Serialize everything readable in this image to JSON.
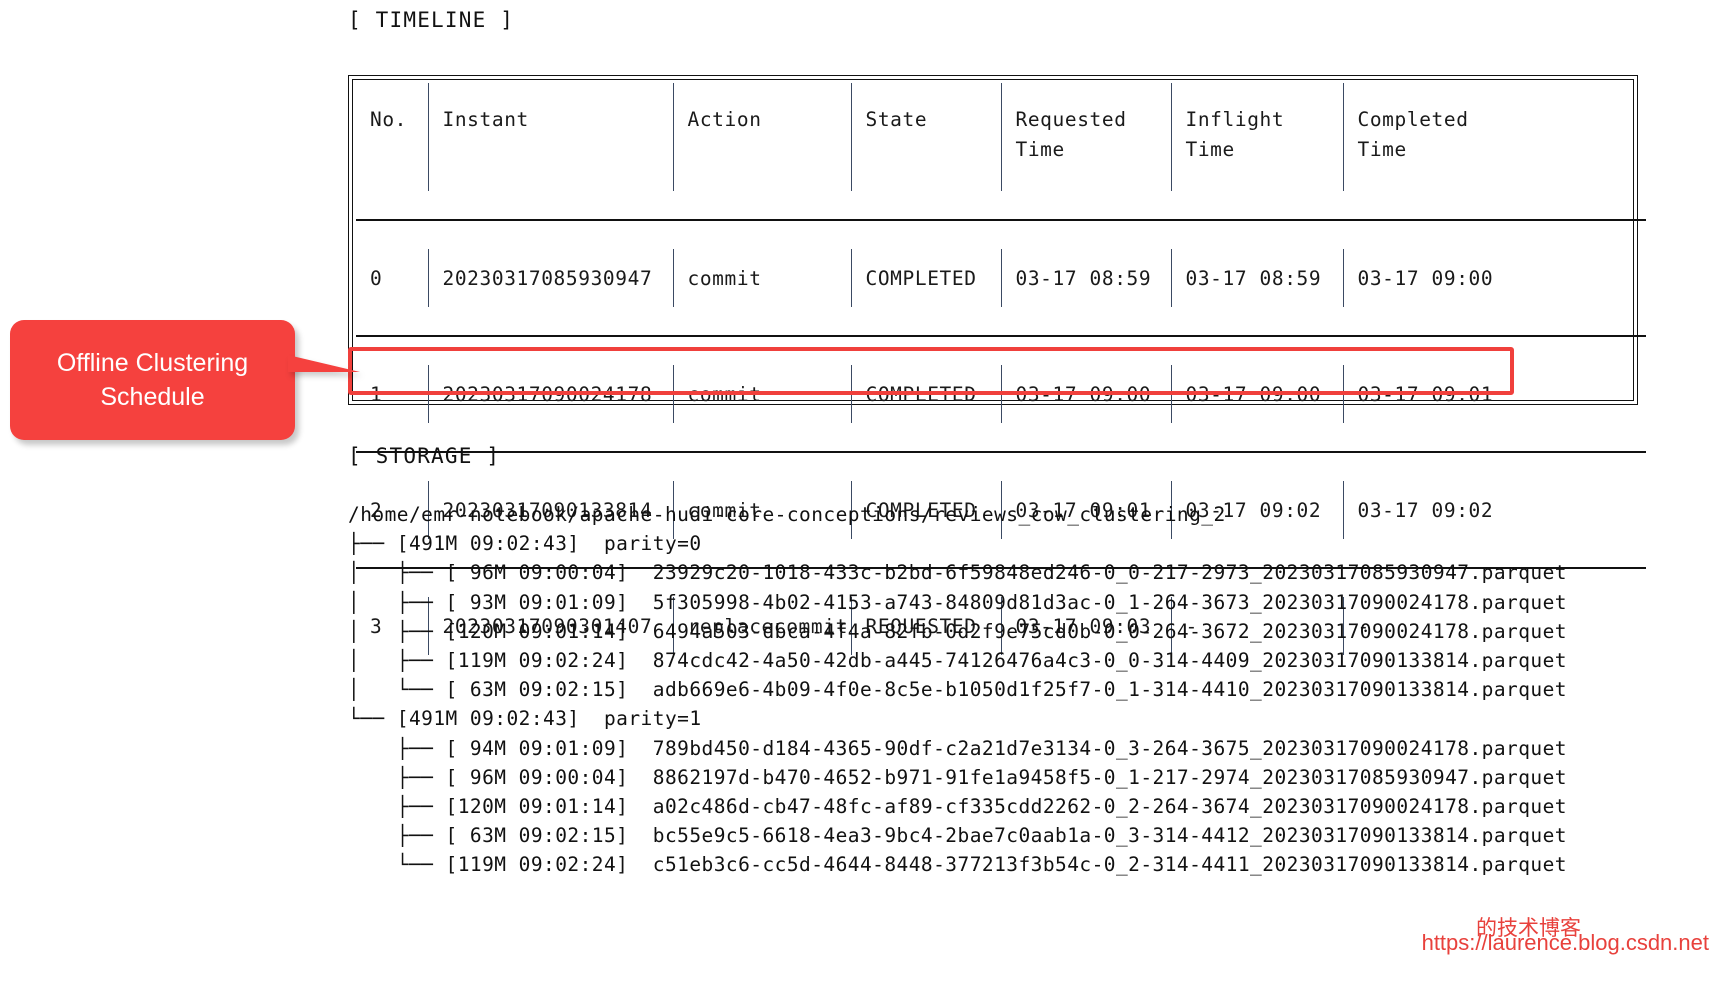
{
  "timeline": {
    "section_label": "[ TIMELINE ]",
    "columns": [
      "No.",
      "Instant",
      "Action",
      "State",
      "Requested\nTime",
      "Inflight\nTime",
      "Completed\nTime"
    ],
    "rows": [
      {
        "no": "0",
        "instant": "20230317085930947",
        "action": "commit",
        "state": "COMPLETED",
        "requested_time": "03-17 08:59",
        "inflight_time": "03-17 08:59",
        "completed_time": "03-17 09:00",
        "highlighted": false
      },
      {
        "no": "1",
        "instant": "20230317090024178",
        "action": "commit",
        "state": "COMPLETED",
        "requested_time": "03-17 09:00",
        "inflight_time": "03-17 09:00",
        "completed_time": "03-17 09:01",
        "highlighted": false
      },
      {
        "no": "2",
        "instant": "20230317090133814",
        "action": "commit",
        "state": "COMPLETED",
        "requested_time": "03-17 09:01",
        "inflight_time": "03-17 09:02",
        "completed_time": "03-17 09:02",
        "highlighted": false
      },
      {
        "no": "3",
        "instant": "20230317090301407",
        "action": "replacecommit",
        "state": "REQUESTED",
        "requested_time": "03-17 09:03",
        "inflight_time": "-",
        "completed_time": "-",
        "highlighted": true
      }
    ]
  },
  "callout": {
    "text": "Offline Clustering\nSchedule",
    "color": "#f5413e"
  },
  "storage": {
    "section_label": "[ STORAGE ]",
    "root_path": "/home/emr-notebook/apache-hudi-core-conceptions/reviews_cow_clustering_2",
    "tree_text": "/home/emr-notebook/apache-hudi-core-conceptions/reviews_cow_clustering_2\n├── [491M 09:02:43]  parity=0\n│   ├── [ 96M 09:00:04]  23929c20-1018-433c-b2bd-6f59848ed246-0_0-217-2973_20230317085930947.parquet\n│   ├── [ 93M 09:01:09]  5f305998-4b02-4153-a743-84809d81d3ac-0_1-264-3673_20230317090024178.parquet\n│   ├── [120M 09:01:14]  6494a503-dbca-4f4a-82fb-0d2f9e75cd0b-0_0-264-3672_20230317090024178.parquet\n│   ├── [119M 09:02:24]  874cdc42-4a50-42db-a445-74126476a4c3-0_0-314-4409_20230317090133814.parquet\n│   └── [ 63M 09:02:15]  adb669e6-4b09-4f0e-8c5e-b1050d1f25f7-0_1-314-4410_20230317090133814.parquet\n└── [491M 09:02:43]  parity=1\n    ├── [ 94M 09:01:09]  789bd450-d184-4365-90df-c2a21d7e3134-0_3-264-3675_20230317090024178.parquet\n    ├── [ 96M 09:00:04]  8862197d-b470-4652-b971-91fe1a9458f5-0_1-217-2974_20230317085930947.parquet\n    ├── [120M 09:01:14]  a02c486d-cb47-48fc-af89-cf335cdd2262-0_2-264-3674_20230317090024178.parquet\n    ├── [ 63M 09:02:15]  bc55e9c5-6618-4ea3-9bc4-2bae7c0aab1a-0_3-314-4412_20230317090133814.parquet\n    └── [119M 09:02:24]  c51eb3c6-cc5d-4644-8448-377213f3b54c-0_2-314-4411_20230317090133814.parquet",
    "partitions": [
      {
        "size": "491M",
        "time": "09:02:43",
        "name": "parity=0",
        "files": [
          {
            "size": " 96M",
            "time": "09:00:04",
            "name": "23929c20-1018-433c-b2bd-6f59848ed246-0_0-217-2973_20230317085930947.parquet"
          },
          {
            "size": " 93M",
            "time": "09:01:09",
            "name": "5f305998-4b02-4153-a743-84809d81d3ac-0_1-264-3673_20230317090024178.parquet"
          },
          {
            "size": "120M",
            "time": "09:01:14",
            "name": "6494a503-dbca-4f4a-82fb-0d2f9e75cd0b-0_0-264-3672_20230317090024178.parquet"
          },
          {
            "size": "119M",
            "time": "09:02:24",
            "name": "874cdc42-4a50-42db-a445-74126476a4c3-0_0-314-4409_20230317090133814.parquet"
          },
          {
            "size": " 63M",
            "time": "09:02:15",
            "name": "adb669e6-4b09-4f0e-8c5e-b1050d1f25f7-0_1-314-4410_20230317090133814.parquet"
          }
        ]
      },
      {
        "size": "491M",
        "time": "09:02:43",
        "name": "parity=1",
        "files": [
          {
            "size": " 94M",
            "time": "09:01:09",
            "name": "789bd450-d184-4365-90df-c2a21d7e3134-0_3-264-3675_20230317090024178.parquet"
          },
          {
            "size": " 96M",
            "time": "09:00:04",
            "name": "8862197d-b470-4652-b971-91fe1a9458f5-0_1-217-2974_20230317085930947.parquet"
          },
          {
            "size": "120M",
            "time": "09:01:14",
            "name": "a02c486d-cb47-48fc-af89-cf335cdd2262-0_2-264-3674_20230317090024178.parquet"
          },
          {
            "size": " 63M",
            "time": "09:02:15",
            "name": "bc55e9c5-6618-4ea3-9bc4-2bae7c0aab1a-0_3-314-4412_20230317090133814.parquet"
          },
          {
            "size": "119M",
            "time": "09:02:24",
            "name": "c51eb3c6-cc5d-4644-8448-377213f3b54c-0_2-314-4411_20230317090133814.parquet"
          }
        ]
      }
    ]
  },
  "watermark": {
    "chinese": "的技术博客",
    "url": "https://laurence.blog.csdn.net",
    "color": "#e8413c"
  }
}
